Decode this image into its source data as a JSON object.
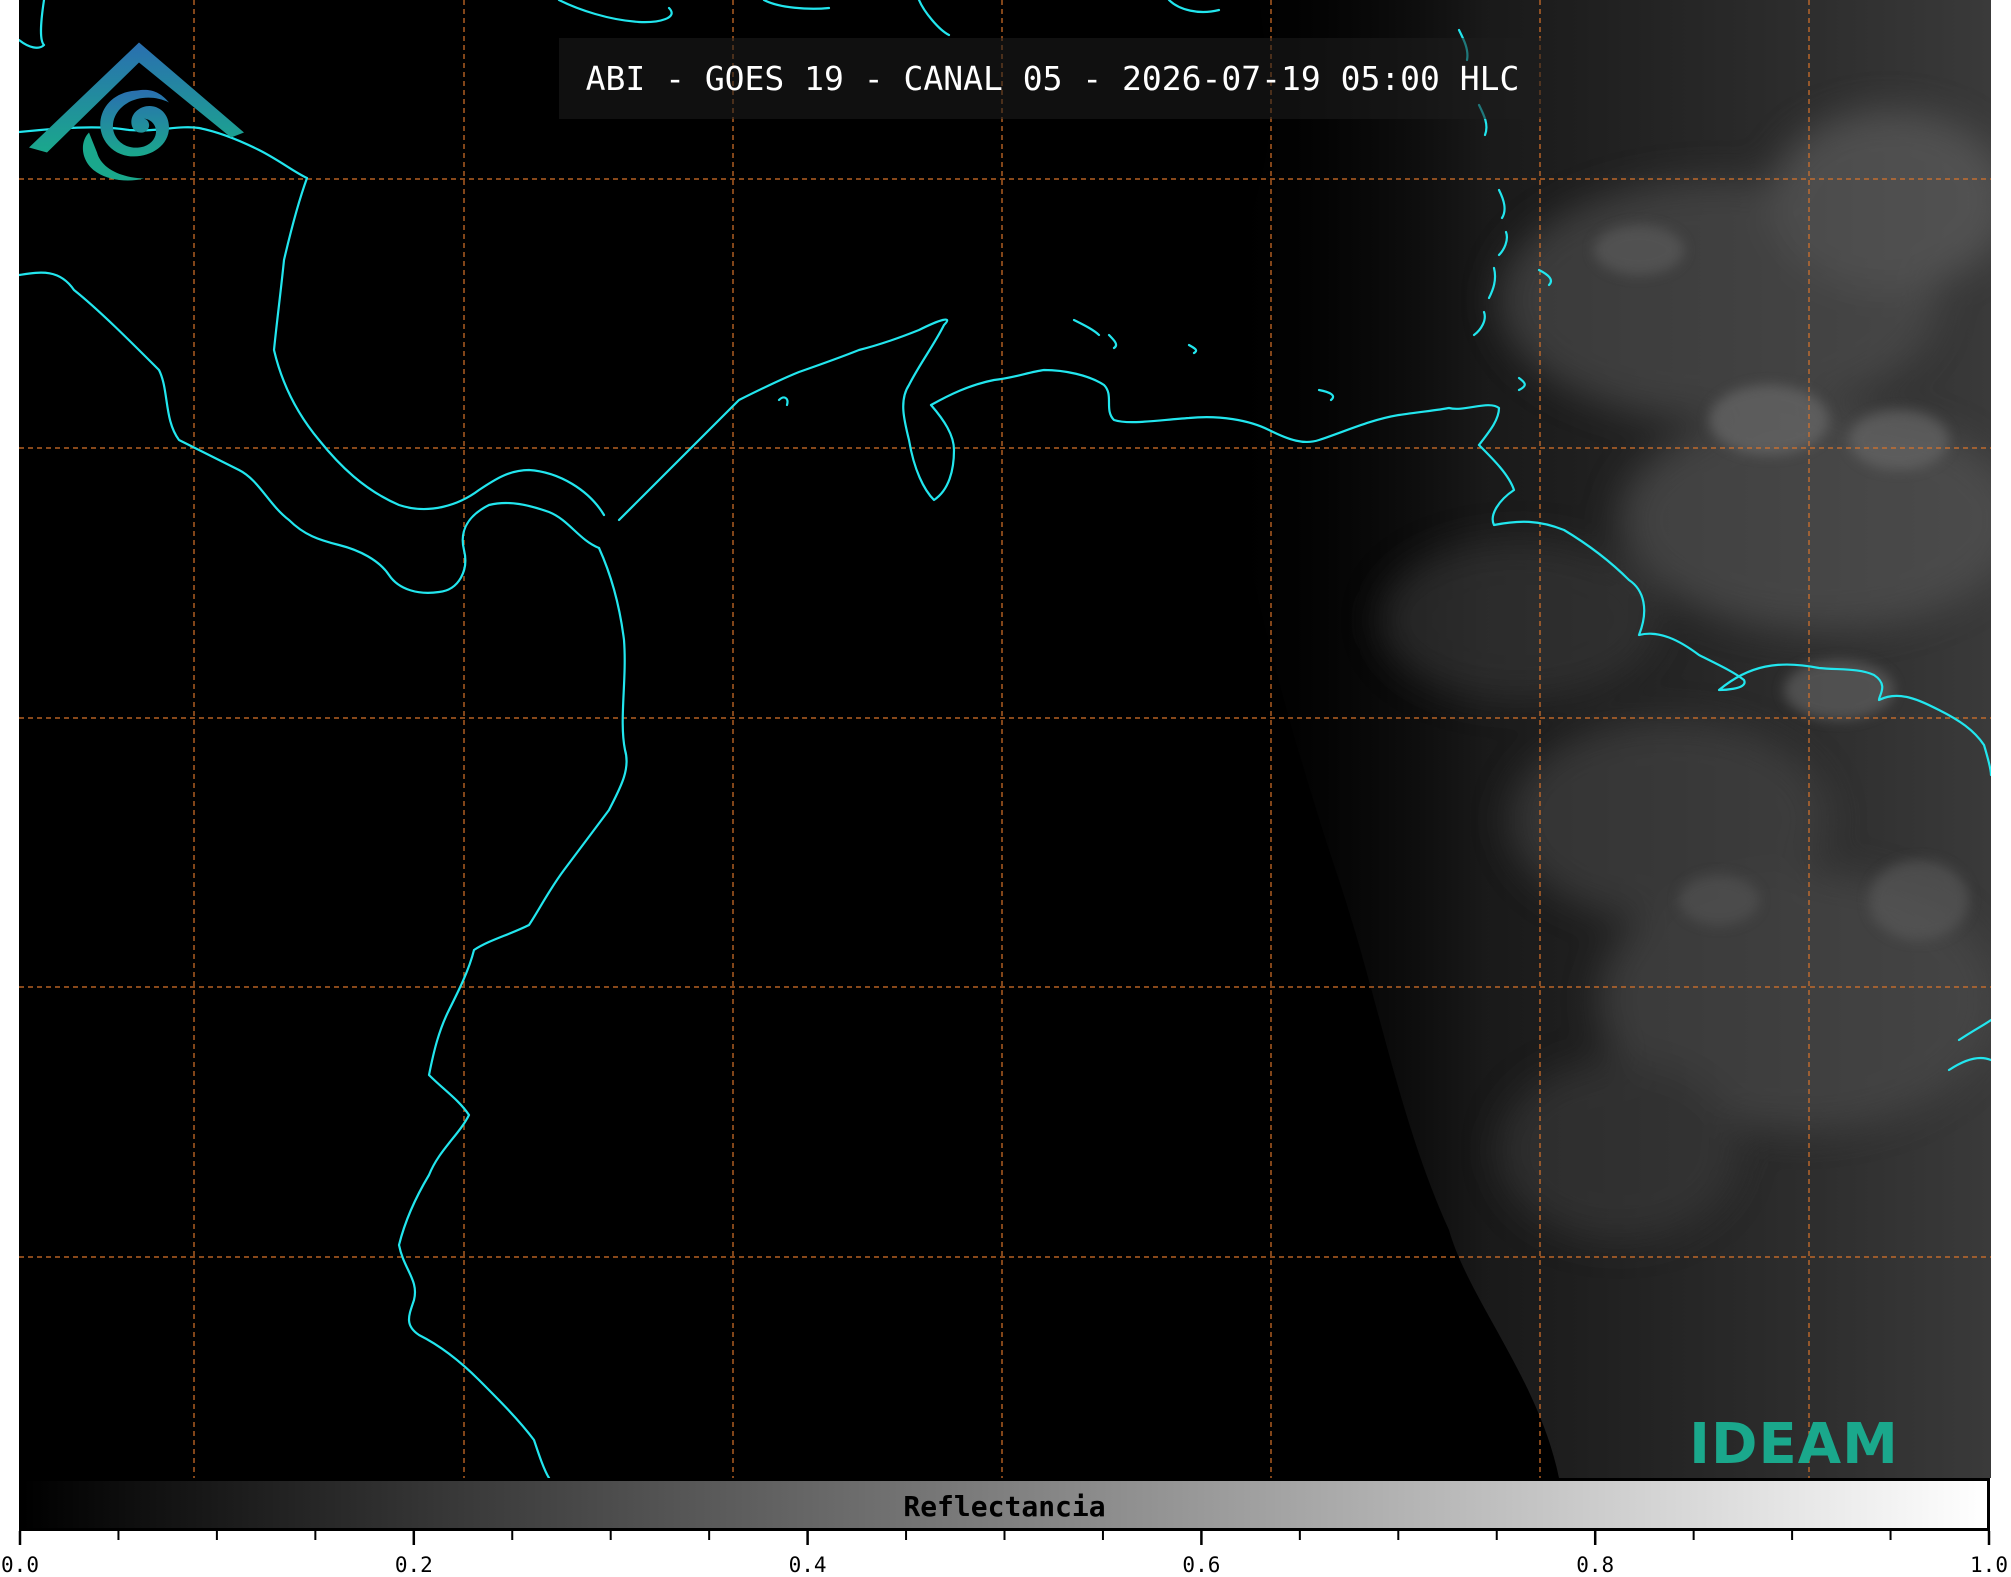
{
  "title": "ABI - GOES 19 - CANAL 05 - 2026-07-19 05:00 HLC",
  "colorbar": {
    "label": "Reflectancia",
    "min": 0.0,
    "max": 1.0,
    "colormap": "grayscale black-to-white",
    "tick_labels": [
      "0.0",
      "0.2",
      "0.4",
      "0.6",
      "0.8",
      "1.0"
    ],
    "minor_tick_step": 0.05
  },
  "logo": {
    "text": "IDEAM"
  },
  "colors": {
    "coastline": "#22e6ee",
    "graticule": "#d9732a",
    "background": "#000000",
    "logo_green": "#1aa88c",
    "logo_blue": "#2a6fb0"
  },
  "map": {
    "graticule_style": "dashed",
    "cloud_region": "eastern side, faint gray clouds"
  }
}
